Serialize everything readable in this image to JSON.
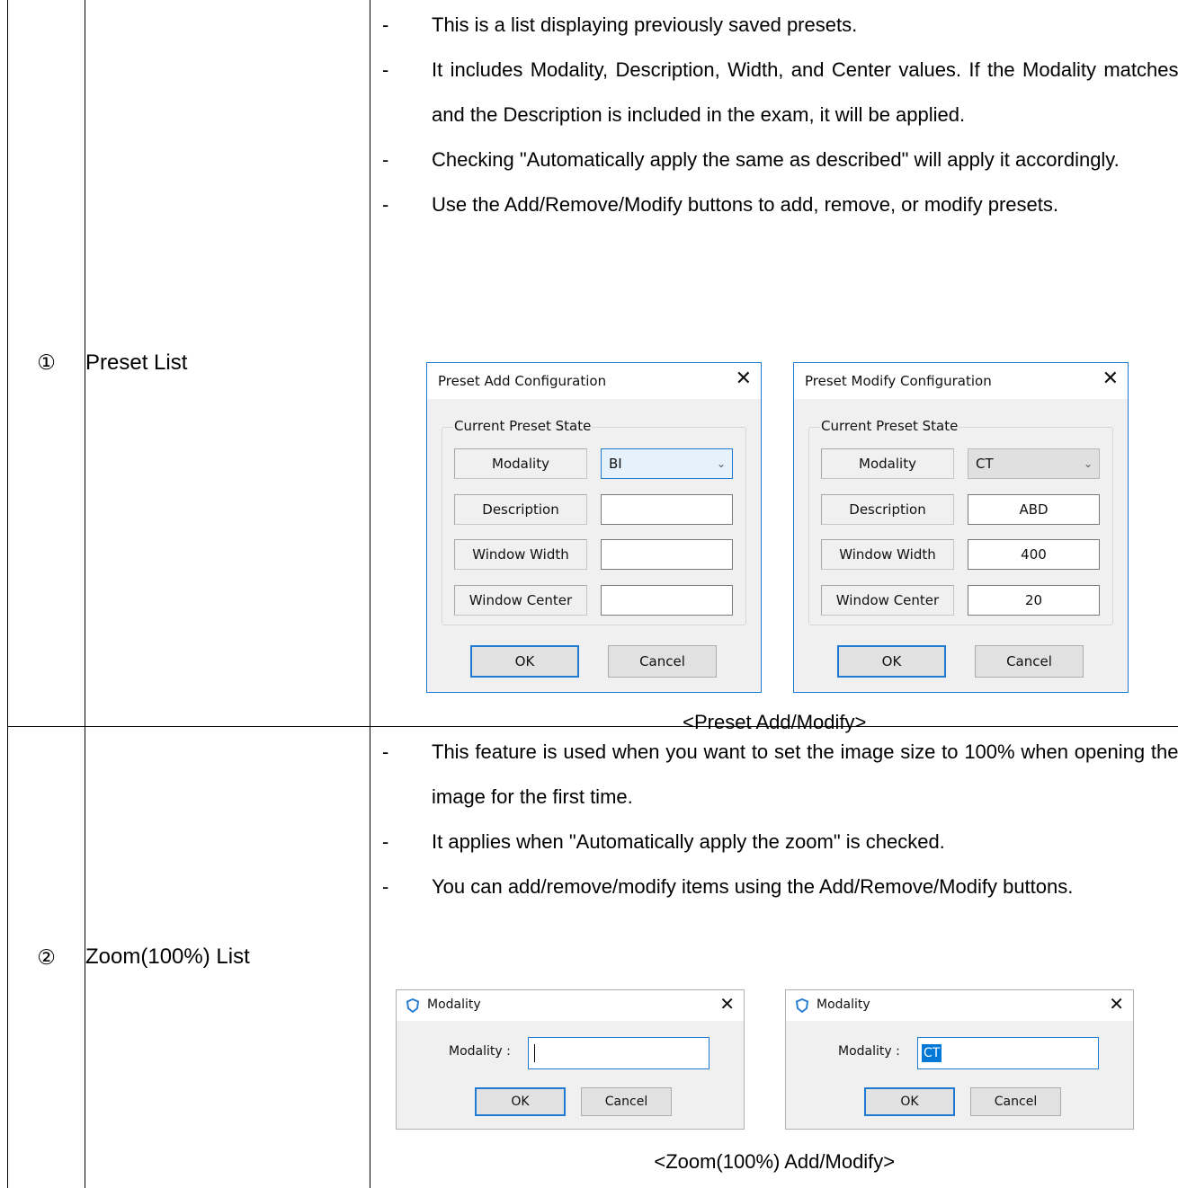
{
  "rows": [
    {
      "number": "①",
      "label": "Preset List",
      "bullets": [
        "This is a list displaying previously saved presets.",
        "It includes Modality, Description, Width, and Center values. If the Modality matches and the Description is included in the exam, it will be applied.",
        "Checking \"Automatically apply the same as described\" will apply it accordingly.",
        "Use the Add/Remove/Modify buttons to add, remove, or modify presets."
      ],
      "caption": "<Preset Add/Modify>"
    },
    {
      "number": "②",
      "label": "Zoom(100%) List",
      "bullets": [
        "This feature is used when you want to set the image size to 100% when opening the image for the first time.",
        "It applies when \"Automatically apply the zoom\" is checked.",
        "You can add/remove/modify items using the Add/Remove/Modify buttons."
      ],
      "caption": "<Zoom(100%) Add/Modify>"
    }
  ],
  "preset_dialogs": [
    {
      "title": "Preset Add Configuration",
      "group_label": "Current Preset State",
      "modality_label": "Modality",
      "modality_value": "BI",
      "description_label": "Description",
      "description_value": "",
      "width_label": "Window Width",
      "width_value": "",
      "center_label": "Window Center",
      "center_value": "",
      "ok_label": "OK",
      "cancel_label": "Cancel",
      "close_glyph": "✕"
    },
    {
      "title": "Preset Modify Configuration",
      "group_label": "Current Preset State",
      "modality_label": "Modality",
      "modality_value": "CT",
      "description_label": "Description",
      "description_value": "ABD",
      "width_label": "Window Width",
      "width_value": "400",
      "center_label": "Window Center",
      "center_value": "20",
      "ok_label": "OK",
      "cancel_label": "Cancel",
      "close_glyph": "✕"
    }
  ],
  "modality_dialogs": [
    {
      "title": "Modality",
      "field_label": "Modality :",
      "field_value": "",
      "ok_label": "OK",
      "cancel_label": "Cancel",
      "close_glyph": "✕"
    },
    {
      "title": "Modality",
      "field_label": "Modality :",
      "field_value": "CT",
      "ok_label": "OK",
      "cancel_label": "Cancel",
      "close_glyph": "✕"
    }
  ],
  "icons": {
    "app_icon": "shield-icon",
    "dropdown": "chevron-down-icon",
    "close": "close-icon"
  },
  "colors": {
    "accent": "#1f7bd1",
    "selection": "#0078d7",
    "dialog_bg": "#f0f0f0"
  }
}
